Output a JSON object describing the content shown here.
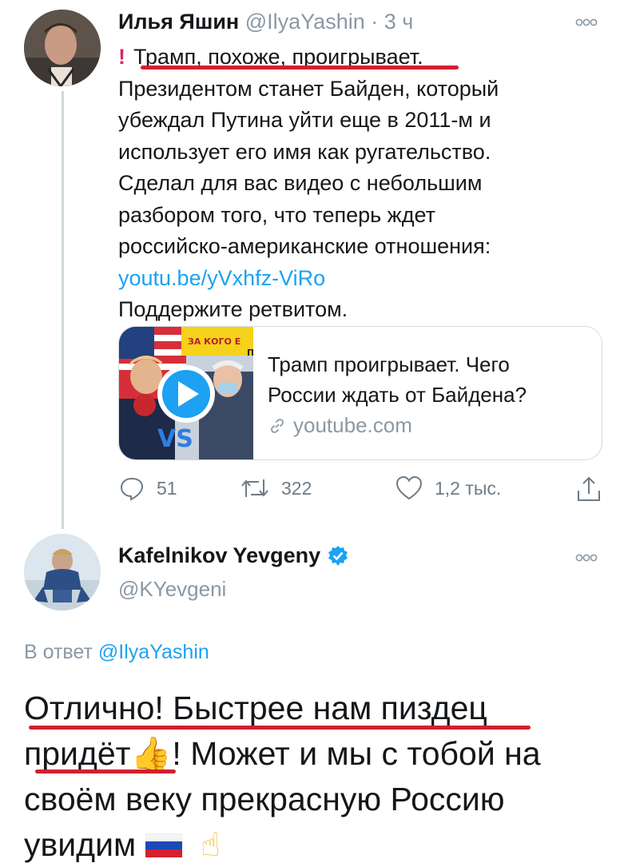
{
  "tweet": {
    "author_name": "Илья Яшин",
    "handle": "@IlyaYashin",
    "separator": "·",
    "time": "3 ч",
    "exclamation": "!",
    "text_lines": [
      "Трамп, похоже, проигрывает.",
      "Президентом станет Байден, который",
      "убеждал Путина уйти еще в 2011-м и",
      "использует его имя как ругательство.",
      "Сделал для вас видео с небольшим",
      "разбором того, что теперь ждет",
      "российско-американские отношения:"
    ],
    "link": "youtu.be/yVxhfz-ViRo",
    "closing_line": "Поддержите ретвитом.",
    "card": {
      "thumb_text_1": "ЗА КОГО Е",
      "thumb_text_2": "П",
      "thumb_vs": "VS",
      "title_line_1": "Трамп проигрывает. Чего",
      "title_line_2": "России ждать от Байдена?",
      "domain": "youtube.com"
    },
    "actions": {
      "replies": "51",
      "retweets": "322",
      "likes": "1,2 тыс."
    }
  },
  "reply": {
    "author_name": "Kafelnikov Yevgeny",
    "handle": "@KYevgeni",
    "reply_to_prefix": "В ответ",
    "reply_to_handle": "@IlyaYashin",
    "text_lines": [
      "Отлично! Быстрее нам пиздец",
      "придёт",
      "! Может и мы с тобой на",
      "своём веку прекрасную Россию",
      "увидим"
    ],
    "emoji_thumbs": "👍",
    "emoji_point": "☝"
  },
  "colors": {
    "link": "#1da1f2",
    "muted": "#8b98a5",
    "highlight": "#d1202e",
    "verified": "#1da1f2"
  },
  "icons": [
    "more-icon",
    "reply-icon",
    "retweet-icon",
    "like-icon",
    "share-icon",
    "link-icon",
    "verified-badge-icon",
    "play-icon"
  ]
}
